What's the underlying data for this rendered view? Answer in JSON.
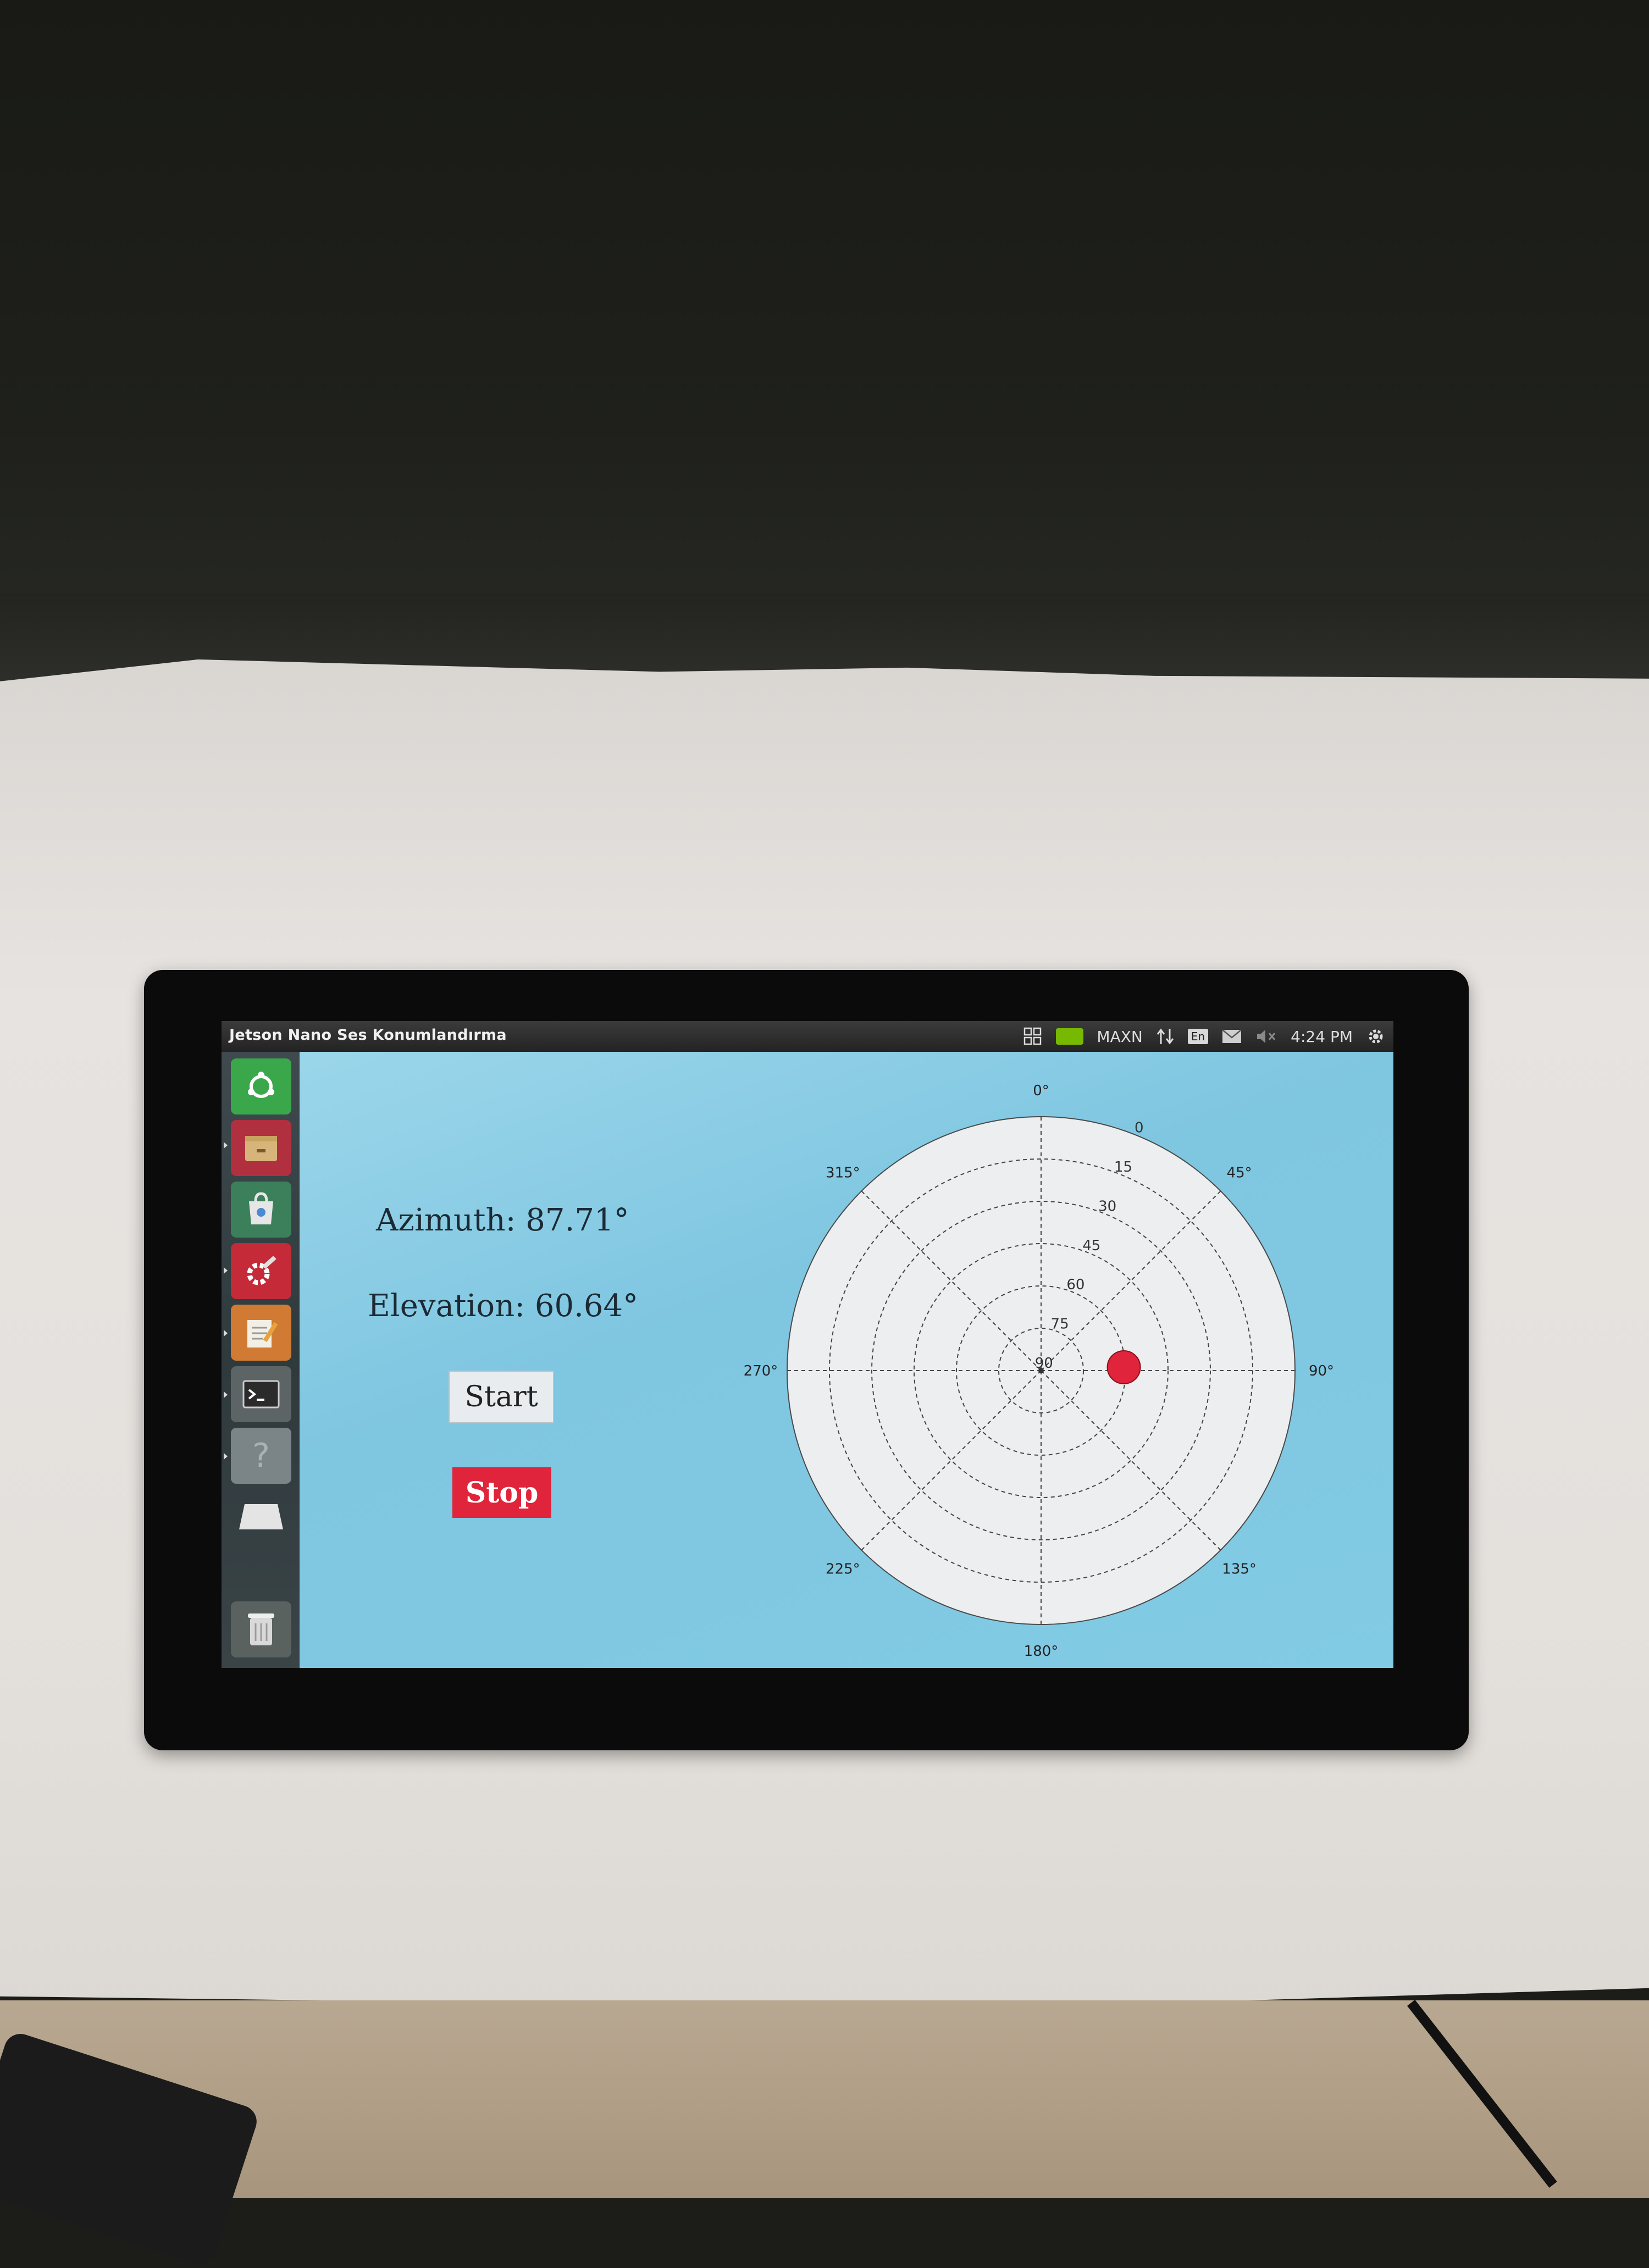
{
  "window": {
    "title": "Jetson Nano Ses Konumlandırma"
  },
  "panel": {
    "power_mode": "MAXN",
    "language": "En",
    "time": "4:24 PM",
    "icons": [
      "workspace-switcher-icon",
      "nvidia-icon",
      "network-icon",
      "keyboard-layout-icon",
      "mail-icon",
      "volume-muted-icon",
      "settings-gear-icon"
    ]
  },
  "launcher": {
    "items": [
      {
        "name": "ubuntu-dash",
        "color": "#3aa84a"
      },
      {
        "name": "file-manager",
        "color": "#b0303f"
      },
      {
        "name": "software-center",
        "color": "#3b7f5b"
      },
      {
        "name": "system-settings",
        "color": "#c42a38"
      },
      {
        "name": "text-editor",
        "color": "#d07a34"
      },
      {
        "name": "terminal",
        "color": "#5c6466"
      },
      {
        "name": "help",
        "color": "#7b8487"
      },
      {
        "name": "drive",
        "color": "#6d7577"
      },
      {
        "name": "trash",
        "color": "#59625f"
      }
    ]
  },
  "app": {
    "azimuth_text": "Azimuth: 87.71°",
    "elevation_text": "Elevation: 60.64°",
    "start_label": "Start",
    "stop_label": "Stop",
    "accent_stop": "#e0243b"
  },
  "polar": {
    "angle_labels": [
      "0°",
      "45°",
      "90°",
      "135°",
      "180°",
      "225°",
      "270°",
      "315°"
    ],
    "angle_values": [
      0,
      45,
      90,
      135,
      180,
      225,
      270,
      315
    ],
    "radial_labels": [
      "0",
      "15",
      "30",
      "45",
      "60",
      "75",
      "90"
    ],
    "radial_values": [
      0,
      15,
      30,
      45,
      60,
      75,
      90
    ],
    "target": {
      "azimuth": 87.71,
      "elevation": 60.64,
      "color": "#e0243b"
    }
  }
}
